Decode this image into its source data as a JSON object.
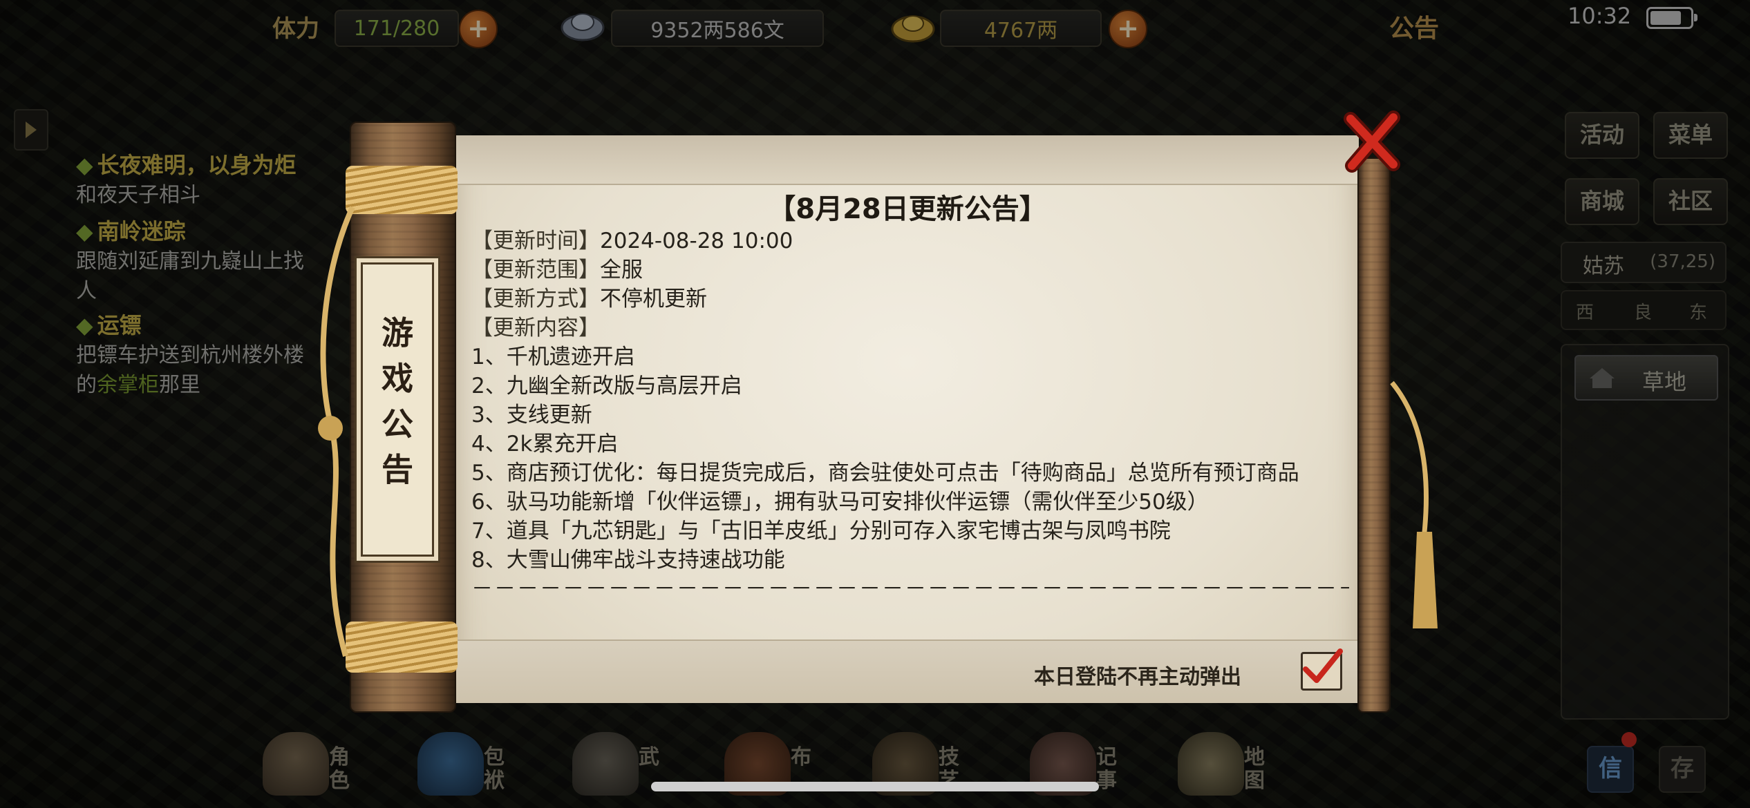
{
  "topbar": {
    "stamina_label": "体力",
    "stamina_value": "171/280",
    "silver_value": "9352两586文",
    "gold_value": "4767两",
    "notice_tab": "公告",
    "time": "10:32",
    "battery_level": 0.78
  },
  "quests": [
    {
      "title": "长夜难明，以身为炬",
      "desc": "和夜天子相斗"
    },
    {
      "title": "南岭迷踪",
      "desc": "跟随刘延庸到九嶷山上找人"
    },
    {
      "title": "运镖",
      "desc_pre": "把镖车护送到杭州楼外楼的",
      "desc_hl": "余掌柜",
      "desc_post": "那里"
    }
  ],
  "side_buttons": {
    "activity": "活动",
    "menu": "菜单",
    "shop": "商城",
    "community": "社区"
  },
  "location": {
    "city": "姑苏",
    "coord": "(37,25)",
    "compass": [
      "西",
      "良",
      "东"
    ],
    "terrain_button": "草地"
  },
  "dock": [
    {
      "icon": "character-icon",
      "label": "角色"
    },
    {
      "icon": "bag-icon",
      "label": "包袱"
    },
    {
      "icon": "martial-arts-icon",
      "label": "武"
    },
    {
      "icon": "formation-icon",
      "label": "布"
    },
    {
      "icon": "skills-icon",
      "label": "技艺"
    },
    {
      "icon": "journal-icon",
      "label": "记事"
    },
    {
      "icon": "map-icon",
      "label": "地图"
    }
  ],
  "mail_label": "信",
  "store_label": "存",
  "modal": {
    "side_tag": [
      "游",
      "戏",
      "公",
      "告"
    ],
    "title": "【8月28日更新公告】",
    "meta": [
      {
        "key": "【更新时间】",
        "value": "2024-08-28  10:00"
      },
      {
        "key": "【更新范围】",
        "value": "全服"
      },
      {
        "key": "【更新方式】",
        "value": "不停机更新"
      },
      {
        "key": "【更新内容】",
        "value": ""
      }
    ],
    "items": [
      "1、千机遗迹开启",
      "2、九幽全新改版与高层开启",
      "3、支线更新",
      "4、2k累充开启",
      "5、商店预订优化：每日提货完成后，商会驻使处可点击「待购商品」总览所有预订商品",
      "6、驮马功能新增「伙伴运镖」，拥有驮马可安排伙伴运镖（需伙伴至少50级）",
      "7、道具「九芯钥匙」与「古旧羊皮纸」分别可存入家宅博古架与凤鸣书院",
      "8、大雪山佛牢战斗支持速战功能"
    ],
    "divider": "－－－－－－－－－－－－－－－－－－－－－－－－－－－－－－－－－－－－－－－－",
    "dont_show_label": "本日登陆不再主动弹出",
    "dont_show_checked": true
  },
  "colors": {
    "paper": "#ece5d4",
    "wood": "#7a5a3c",
    "accent_red": "#c8261c",
    "quest_title": "#c9b24a"
  }
}
